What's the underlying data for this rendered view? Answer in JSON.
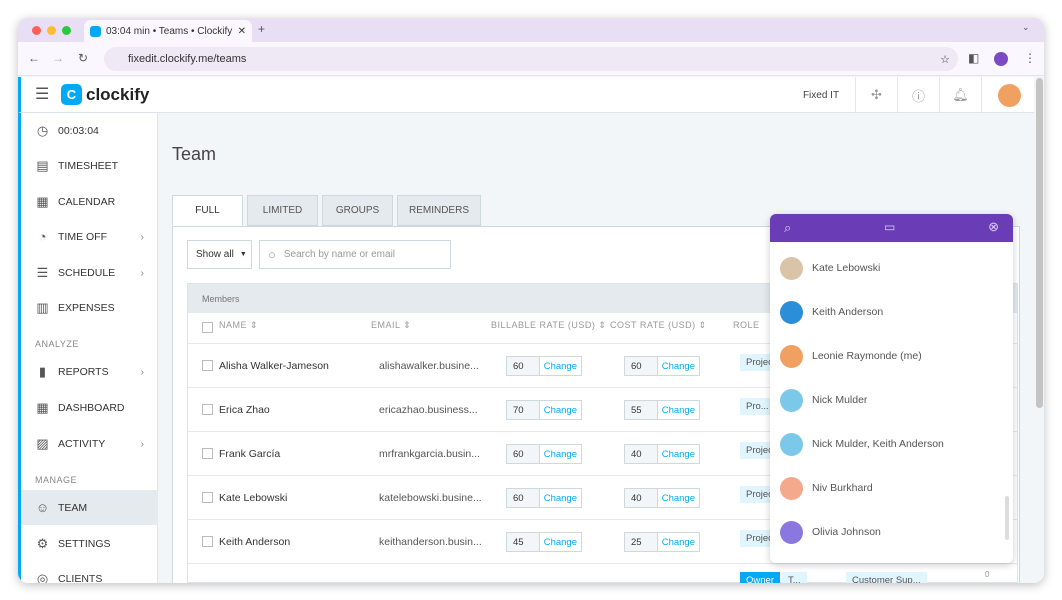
{
  "browser": {
    "tab_title": "03:04 min • Teams • Clockify",
    "url": "fixedit.clockify.me/teams"
  },
  "header": {
    "logo": "clockify",
    "workspace": "Fixed IT"
  },
  "sidebar": {
    "timer": "00:03:04",
    "items": [
      {
        "label": "TIMESHEET",
        "icon": "timesheet-icon"
      },
      {
        "label": "CALENDAR",
        "icon": "calendar-icon"
      },
      {
        "label": "TIME OFF",
        "icon": "clock-icon",
        "chevron": true
      },
      {
        "label": "SCHEDULE",
        "icon": "schedule-icon",
        "chevron": true
      },
      {
        "label": "EXPENSES",
        "icon": "receipt-icon"
      }
    ],
    "analyze_label": "ANALYZE",
    "analyze": [
      {
        "label": "REPORTS",
        "chevron": true
      },
      {
        "label": "DASHBOARD"
      },
      {
        "label": "ACTIVITY",
        "chevron": true
      }
    ],
    "manage_label": "MANAGE",
    "manage": [
      {
        "label": "TEAM"
      },
      {
        "label": "SETTINGS"
      },
      {
        "label": "CLIENTS"
      }
    ]
  },
  "page": {
    "title": "Team",
    "tabs": [
      "FULL",
      "LIMITED",
      "GROUPS",
      "REMINDERS"
    ],
    "filter": "Show all",
    "search_placeholder": "Search by name or email"
  },
  "table": {
    "section": "Members",
    "columns": [
      "NAME",
      "EMAIL",
      "BILLABLE RATE (USD)",
      "COST RATE (USD)",
      "ROLE"
    ],
    "change_label": "Change",
    "rows": [
      {
        "name": "Alisha Walker-Jameson",
        "email": "alishawalker.busine...",
        "billable": "60",
        "cost": "60",
        "role": "Projec"
      },
      {
        "name": "Erica Zhao",
        "email": "ericazhao.business...",
        "billable": "70",
        "cost": "55",
        "role": "Pro..."
      },
      {
        "name": "Frank García",
        "email": "mrfrankgarcia.busin...",
        "billable": "60",
        "cost": "40",
        "role": "Projec"
      },
      {
        "name": "Kate Lebowski",
        "email": "katelebowski.busine...",
        "billable": "60",
        "cost": "40",
        "role": "Projec"
      },
      {
        "name": "Keith Anderson",
        "email": "keithanderson.busin...",
        "billable": "45",
        "cost": "25",
        "role": "Projec"
      }
    ],
    "partial_row": {
      "role": "Owner",
      "role2": "T...",
      "group": "Customer Sup...",
      "count": "0"
    }
  },
  "popup": {
    "users": [
      "Kate Lebowski",
      "Keith Anderson",
      "Leonie Raymonde (me)",
      "Nick Mulder",
      "Nick Mulder, Keith Anderson",
      "Niv Burkhard",
      "Olivia Johnson"
    ],
    "avatar_colors": [
      "#d9c4a8",
      "#2a8fd8",
      "#f0a060",
      "#7cc8ea",
      "#7cc8ea",
      "#f4a88c",
      "#8a78e0"
    ]
  },
  "colors": {
    "accent": "#03a9f4",
    "popup": "#6a3cb5"
  }
}
